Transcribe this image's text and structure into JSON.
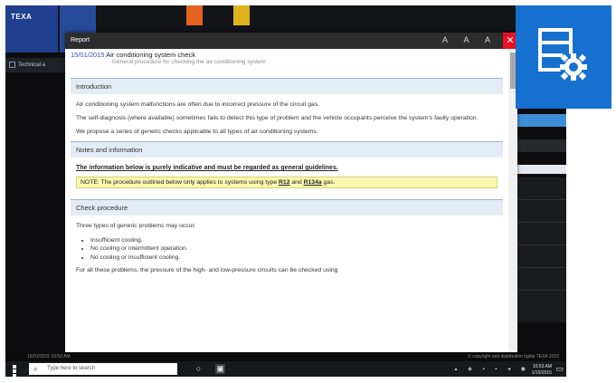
{
  "taskbar_app": {
    "brand": "TEXA"
  },
  "underlying_app": {
    "tech_label": "Technical a"
  },
  "report": {
    "window_title": "Report",
    "close_glyph": "✕",
    "doc_date": "15/01/2015",
    "doc_title": "Air conditioning system check",
    "doc_subtitle": "General procedure for checking the air conditioning system",
    "sections": {
      "introduction": {
        "heading": "Introduction",
        "p1": "Air conditioning system malfunctions are often due to incorrect pressure of the circuit gas.",
        "p2": "The self-diagnosis (where available) sometimes fails to detect this type of problem and the vehicle occupants perceive the system's faulty operation.",
        "p3": "We propose a series of generic checks applicable to all types of air conditioning systems."
      },
      "notes": {
        "heading": "Notes and information",
        "guideline": "The information below is purely indicative and must be regarded as general guidelines.",
        "note_prefix": "NOTE: The procedure outlined below only applies to systems using type",
        "note_r12": "R12",
        "note_and": "and",
        "note_r134a": "R134a",
        "note_suffix": "gas."
      },
      "check": {
        "heading": "Check procedure",
        "intro": "Three types of generic problems may occur:",
        "bullets": [
          "Insufficient cooling.",
          "No cooling or intermittent operation.",
          "No cooling or insufficient cooling."
        ],
        "closing": "For all these problems, the pressure of the high- and low-pressure circuits can be checked using"
      }
    }
  },
  "status": {
    "left": "15/01/2015 10:53 AM",
    "right": "© copyright and distribution rights TEXA 2015"
  },
  "taskbar": {
    "search_placeholder": "Type here to search",
    "clock_time": "10:53 AM",
    "clock_date": "1/15/2015"
  },
  "colors": {
    "accent_tile": "#1670cf",
    "section_header": "#e3ebf6",
    "note_highlight": "#fbf8b2",
    "close_button": "#e81123"
  },
  "icons": [
    "windows-start-icon",
    "search-icon",
    "task-view-icon",
    "app-icon",
    "settings-document-gear-icon"
  ]
}
